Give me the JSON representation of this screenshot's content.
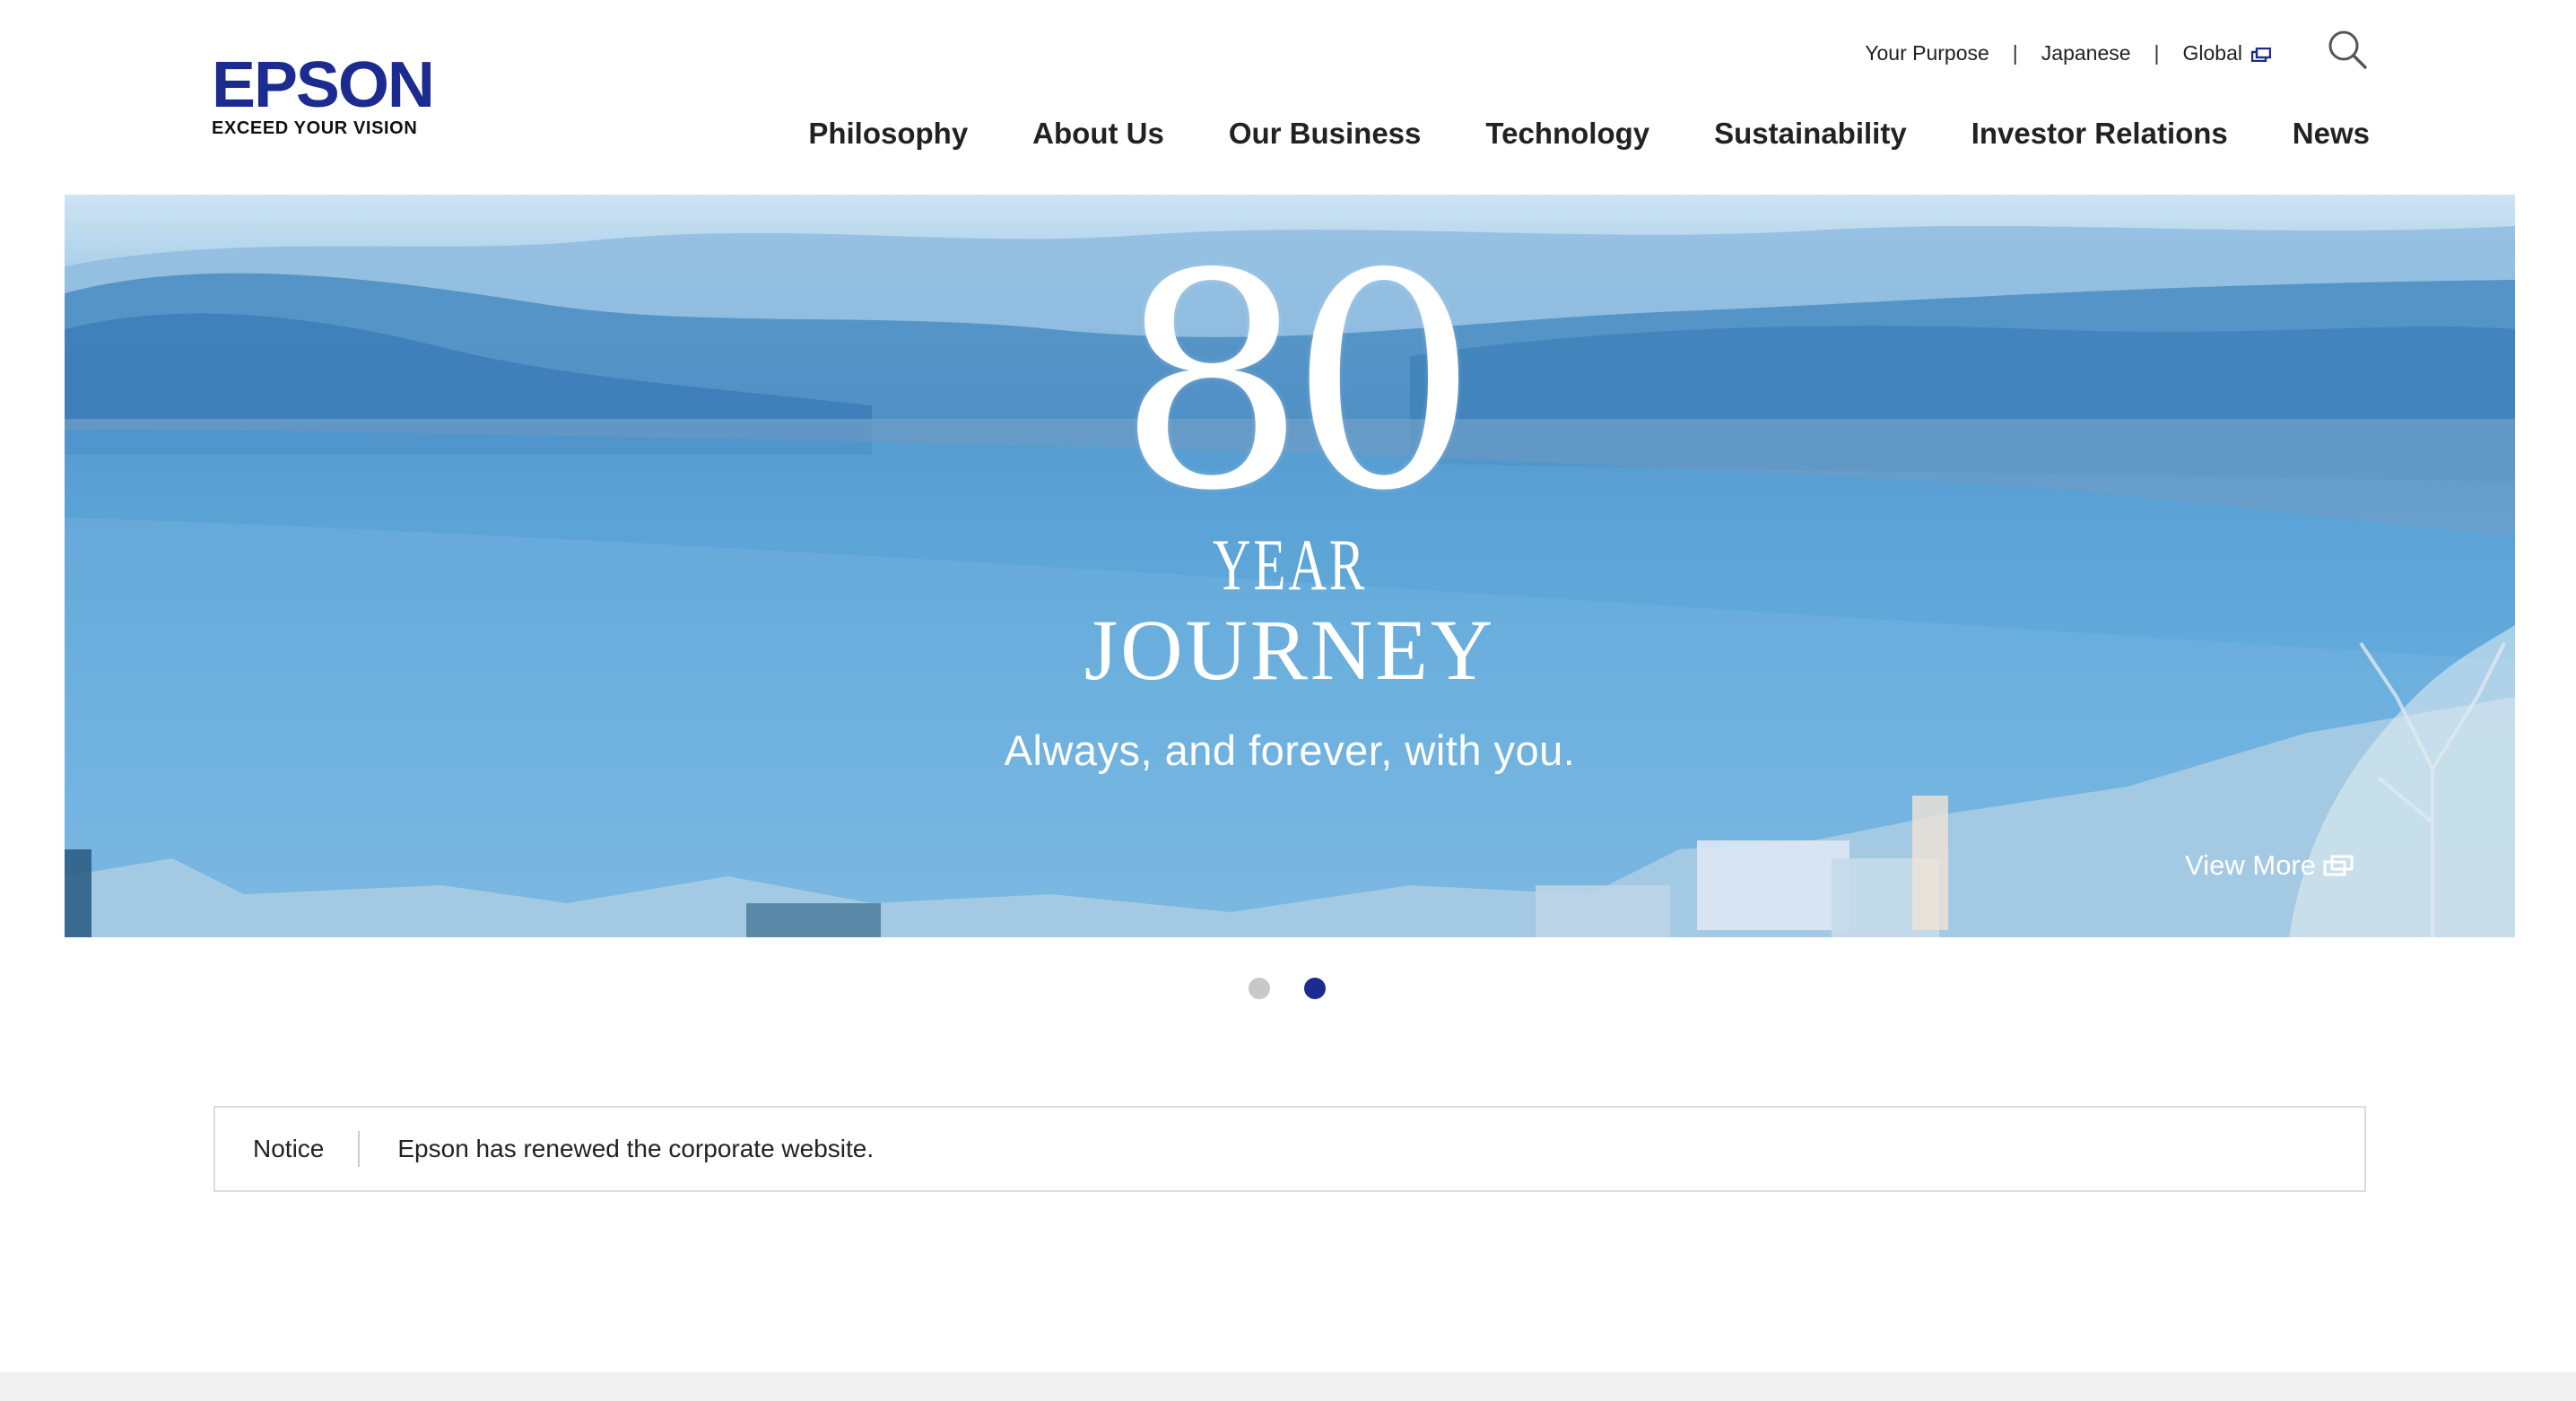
{
  "brand": {
    "name": "EPSON",
    "tagline": "EXCEED YOUR VISION",
    "color": "#1c2b8f"
  },
  "utility_nav": {
    "items": [
      {
        "label": "Your Purpose"
      },
      {
        "label": "Japanese"
      },
      {
        "label": "Global",
        "icon": "external-link-icon"
      }
    ],
    "separator": "|",
    "search_icon": "search-icon"
  },
  "main_nav": {
    "items": [
      {
        "label": "Philosophy"
      },
      {
        "label": "About Us"
      },
      {
        "label": "Our Business"
      },
      {
        "label": "Technology"
      },
      {
        "label": "Sustainability"
      },
      {
        "label": "Investor Relations"
      },
      {
        "label": "News"
      }
    ]
  },
  "hero": {
    "number": "80",
    "year": "YEAR",
    "journey": "JOURNEY",
    "tagline": "Always, and forever, with you.",
    "view_more": "View More",
    "view_more_icon": "external-link-icon"
  },
  "carousel": {
    "slides": 2,
    "active_index": 1,
    "inactive_color": "#c8c8c8",
    "active_color": "#1c2b8f"
  },
  "notice": {
    "label": "Notice",
    "text": "Epson has renewed the corporate website."
  }
}
